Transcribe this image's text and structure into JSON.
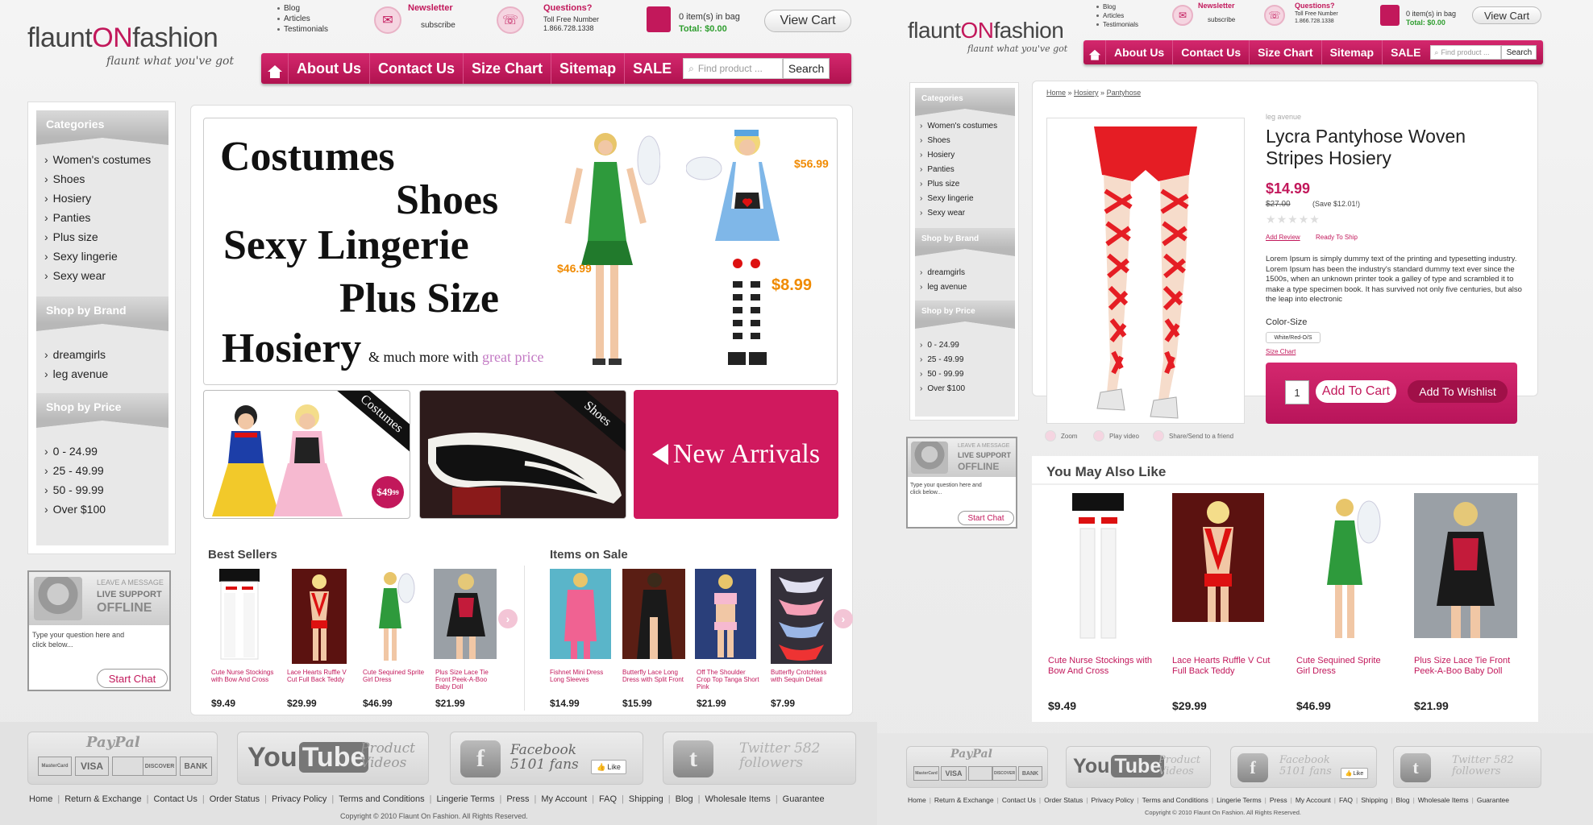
{
  "brand": {
    "logo_a": "flaunt",
    "logo_on": "ON",
    "logo_b": "fashion",
    "tagline": "flaunt what you've got"
  },
  "top_links": [
    "Blog",
    "Articles",
    "Testimonials"
  ],
  "newsletter": {
    "title": "Newsletter",
    "action": "subscribe",
    "icon": "envelope-icon"
  },
  "questions": {
    "title": "Questions?",
    "line1": "Toll Free Number",
    "phone": "1.866.728.1338",
    "icon": "phone-icon"
  },
  "bag": {
    "items": "0 item(s) in bag",
    "total_label": "Total:",
    "total": "$0.00",
    "view_cart": "View Cart"
  },
  "nav": {
    "items": [
      "About Us",
      "Contact Us",
      "Size Chart",
      "Sitemap",
      "SALE"
    ],
    "search_placeholder": "Find product ...",
    "search_button": "Search"
  },
  "sidebar": {
    "categories_title": "Categories",
    "categories": [
      "Women's costumes",
      "Shoes",
      "Hosiery",
      "Panties",
      "Plus size",
      "Sexy lingerie",
      "Sexy wear"
    ],
    "brand_title": "Shop by Brand",
    "brands": [
      "dreamgirls",
      "leg avenue"
    ],
    "price_title": "Shop by Price",
    "prices": [
      "0 - 24.99",
      "25 - 49.99",
      "50 - 99.99",
      "Over $100"
    ]
  },
  "chat": {
    "line1": "LEAVE A MESSAGE",
    "line2": "LIVE SUPPORT",
    "line3": "OFFLINE",
    "placeholder": "Type your question here and click below...",
    "button": "Start Chat"
  },
  "banner": {
    "words": [
      "Costumes",
      "Shoes",
      "Sexy Lingerie",
      "Plus Size",
      "Hosiery"
    ],
    "more": "& much more with",
    "great": "great price",
    "price1": "$46.99",
    "price2": "$56.99",
    "price3": "$8.99"
  },
  "tiles": {
    "costumes": "Costumes",
    "costume_price": "$49",
    "costume_cents": "99",
    "shoes": "Shoes",
    "arrivals": "New Arrivals"
  },
  "best_sellers": {
    "title": "Best Sellers",
    "items": [
      {
        "name": "Cute Nurse Stockings with Bow And Cross",
        "price": "$9.49"
      },
      {
        "name": "Lace Hearts Ruffle V Cut Full Back Teddy",
        "price": "$29.99"
      },
      {
        "name": "Cute Sequined Sprite Girl Dress",
        "price": "$46.99"
      },
      {
        "name": "Plus Size Lace Tie Front Peek-A-Boo Baby Doll",
        "price": "$21.99"
      }
    ]
  },
  "items_on_sale": {
    "title": "Items on Sale",
    "items": [
      {
        "name": "Fishnet Mini Dress Long Sleeves",
        "price": "$14.99"
      },
      {
        "name": "Butterfly Lace Long Dress with Split Front",
        "price": "$15.99"
      },
      {
        "name": "Off The Shoulder Crop Top Tanga Short Pink",
        "price": "$21.99"
      },
      {
        "name": "Butterfly Crotchless with Sequin Detail",
        "price": "$7.99"
      }
    ]
  },
  "footer": {
    "paypal": "PayPal",
    "cards": [
      "MasterCard",
      "VISA",
      "",
      "DISCOVER",
      "BANK"
    ],
    "youtube_a": "You",
    "youtube_b": "Tube",
    "yt_label": "Product Videos",
    "facebook": "Facebook 5101 fans",
    "like": "Like",
    "twitter": "Twitter 582 followers",
    "links": [
      "Home",
      "Return & Exchange",
      "Contact Us",
      "Order Status",
      "Privacy Policy",
      "Terms and Conditions",
      "Lingerie Terms",
      "Press",
      "My Account",
      "FAQ",
      "Shipping",
      "Blog",
      "Wholesale Items",
      "Guarantee"
    ],
    "copyright": "Copyright © 2010 Flaunt On Fashion. All Rights Reserved."
  },
  "product": {
    "breadcrumb": [
      "Home",
      "Hosiery",
      "Pantyhose"
    ],
    "brand": "leg avenue",
    "title": "Lycra Pantyhose Woven Stripes Hosiery",
    "price": "$14.99",
    "old_price": "$27.00",
    "save": "(Save $12.01!)",
    "add_review": "Add Review",
    "ready": "Ready To Ship",
    "description": "Lorem Ipsum is simply dummy text of the printing and typesetting industry. Lorem Ipsum has been the industry's standard dummy text ever since the 1500s, when an unknown printer took a galley of type and scrambled it to make a type specimen book. It has survived not only five centuries, but also the leap into electronic",
    "color_size_label": "Color-Size",
    "color_size_value": "White/Red-O/S",
    "size_chart": "Size Chart",
    "qty": "1",
    "add_to_cart": "Add To Cart",
    "add_to_wishlist": "Add To Wishlist",
    "tools": [
      "Zoom",
      "Play video",
      "Share/Send to a friend"
    ]
  },
  "also_like": {
    "title": "You May Also Like",
    "items": [
      {
        "name": "Cute Nurse Stockings with Bow And Cross",
        "price": "$9.49"
      },
      {
        "name": "Lace Hearts Ruffle V Cut Full Back Teddy",
        "price": "$29.99"
      },
      {
        "name": "Cute Sequined Sprite Girl Dress",
        "price": "$46.99"
      },
      {
        "name": "Plus Size Lace Tie Front Peek-A-Boo Baby Doll",
        "price": "$21.99"
      }
    ]
  },
  "colors": {
    "brand_pink": "#c2185b",
    "price_orange": "#f08a00",
    "total_green": "#2e9d2e"
  }
}
